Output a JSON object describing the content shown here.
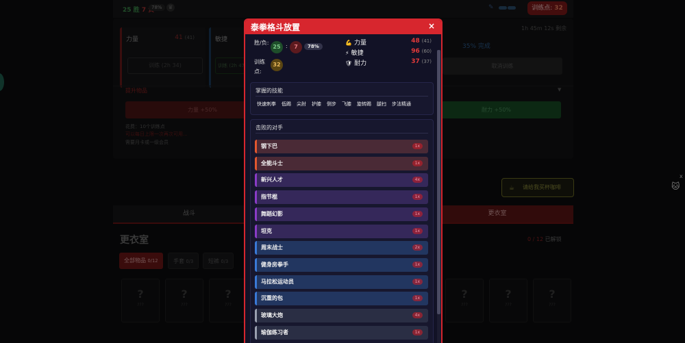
{
  "background": {
    "topbar": {
      "wins_text": "25 胜",
      "losses_text": "7 负",
      "win_pct": "78%"
    },
    "training_points_label": "训练点:",
    "training_points_value": "32",
    "stats": [
      {
        "name": "力量",
        "value": "41",
        "sub": "(41)",
        "btn": "训练 (2h 34)"
      },
      {
        "name": "敏捷",
        "btn": "训练 (2h 47)"
      }
    ],
    "remaining": "1h 45m 12s 剩余",
    "done_pct": "35% 完成",
    "cancel": "取消训练",
    "boost_title": "提升物品",
    "boost_left": "力量 +50%",
    "boost_right": "耐力 +50%",
    "notes": [
      "花费：10个训练点",
      "可以每日上限一次再次可用...",
      "需要月卡或一级会员"
    ],
    "coffee": "请给我买杯咖啡",
    "tabs": [
      "战斗",
      "更衣室"
    ],
    "locker_title": "更衣室",
    "unlock_count": "0 / 12",
    "unlock_suffix": "已解锁",
    "filters": [
      {
        "label": "全部物品",
        "count": "0/12"
      },
      {
        "label": "手套",
        "count": "0/3"
      },
      {
        "label": "短裤",
        "count": "0/3"
      }
    ],
    "slot_mark": "?",
    "slot_label": "???"
  },
  "modal": {
    "title": "泰拳格斗放置",
    "close": "×",
    "record": {
      "label_wl": "胜/负:",
      "wins": "25",
      "colon": ":",
      "losses": "7",
      "pct": "78%",
      "label_pts": "训练点:",
      "points": "32"
    },
    "stats": [
      {
        "icon": "💪",
        "name": "力量",
        "value": "48",
        "base": "(41)"
      },
      {
        "icon": "⚡",
        "name": "敏捷",
        "value": "96",
        "base": "(60)"
      },
      {
        "icon": "🛡",
        "name": "耐力",
        "value": "37",
        "base": "(37)"
      }
    ],
    "skills_title": "掌握的技能",
    "skills": [
      "快速刺拳",
      "低踢",
      "尖肘",
      "护膝",
      "侧步",
      "飞膝",
      "旋转踢",
      "腿扫",
      "步法精通"
    ],
    "opponents_title": "击败的对手",
    "opponents": [
      {
        "name": "钢下巴",
        "count": "1x",
        "color": "#4a2a36",
        "border": "#e2572f"
      },
      {
        "name": "全能斗士",
        "count": "1x",
        "color": "#4a2a36",
        "border": "#e2572f"
      },
      {
        "name": "新兴人才",
        "count": "4x",
        "color": "#35285a",
        "border": "#8a3cc8"
      },
      {
        "name": "指节棍",
        "count": "1x",
        "color": "#35285a",
        "border": "#8a3cc8"
      },
      {
        "name": "舞蹈幻影",
        "count": "1x",
        "color": "#35285a",
        "border": "#8a3cc8"
      },
      {
        "name": "坦克",
        "count": "1x",
        "color": "#35285a",
        "border": "#8a3cc8"
      },
      {
        "name": "周末战士",
        "count": "2x",
        "color": "#223660",
        "border": "#3a7ad8"
      },
      {
        "name": "健身房拳手",
        "count": "1x",
        "color": "#223660",
        "border": "#3a7ad8"
      },
      {
        "name": "马拉松运动员",
        "count": "1x",
        "color": "#223660",
        "border": "#3a7ad8"
      },
      {
        "name": "沉重的包",
        "count": "1x",
        "color": "#223660",
        "border": "#3a7ad8"
      },
      {
        "name": "玻璃大炮",
        "count": "4x",
        "color": "#2a2e44",
        "border": "#9aa0b0"
      },
      {
        "name": "瑜伽练习者",
        "count": "1x",
        "color": "#2a2e44",
        "border": "#9aa0b0"
      }
    ]
  }
}
